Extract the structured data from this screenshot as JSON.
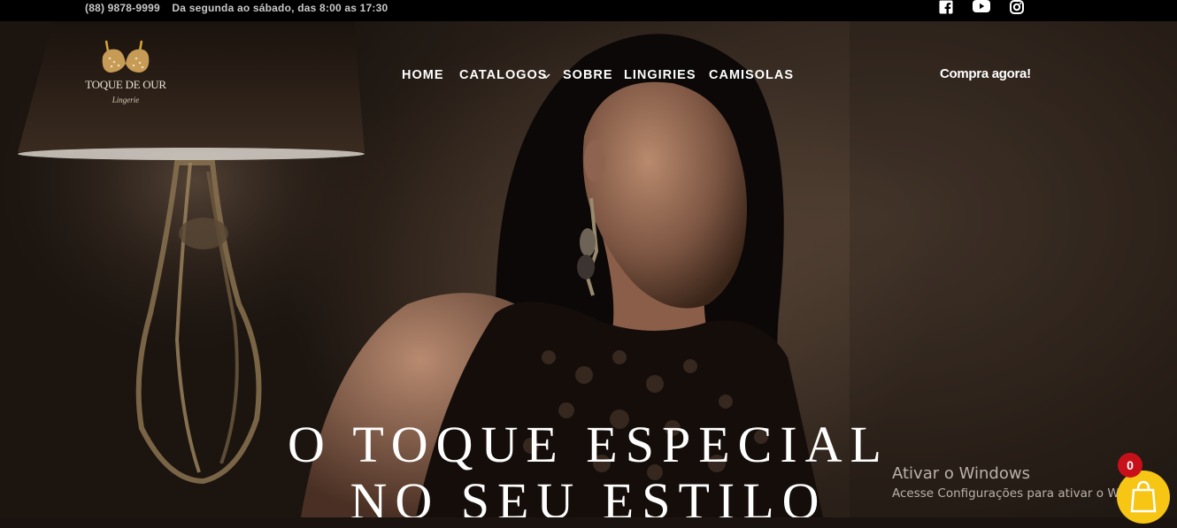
{
  "topbar": {
    "phone": "(88) 9878-9999",
    "hours": "Da segunda ao sábado, das 8:00 as 17:30",
    "social": [
      {
        "icon": "facebook-icon"
      },
      {
        "icon": "youtube-icon"
      },
      {
        "icon": "instagram-icon"
      }
    ]
  },
  "logo": {
    "brand": "TOQUE DE OUR",
    "subtitle": "Lingerie"
  },
  "nav": {
    "items": [
      {
        "label": "HOME"
      },
      {
        "label": "CATALOGOS",
        "has_dropdown": true
      },
      {
        "label": "SOBRE"
      },
      {
        "label": "LINGIRIES"
      },
      {
        "label": "CAMISOLAS"
      }
    ]
  },
  "cta": {
    "label": "Compra agora!"
  },
  "hero": {
    "headline_line1": "O TOQUE ESPECIAL",
    "headline_line2": "NO SEU ESTILO"
  },
  "watermark": {
    "title": "Ativar o Windows",
    "subtitle": "Acesse Configurações para ativar o Windows."
  },
  "cart": {
    "count": "0",
    "icon": "shopping-bag-icon"
  },
  "colors": {
    "topbar": "#000000",
    "cart_button": "#f7c514",
    "cart_badge": "#c8101a"
  }
}
